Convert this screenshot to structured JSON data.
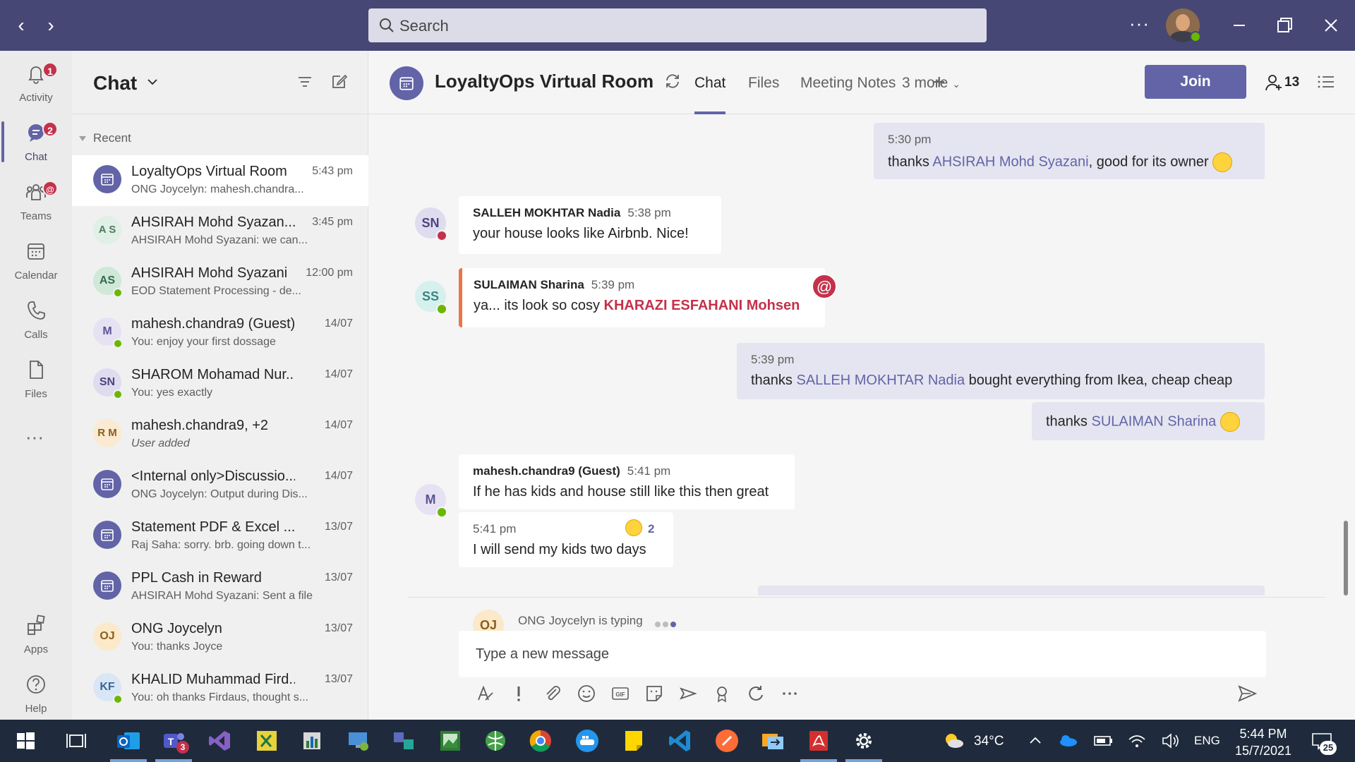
{
  "titlebar": {
    "search_placeholder": "Search",
    "more": "···"
  },
  "rail": [
    {
      "label": "Activity",
      "badge": "1"
    },
    {
      "label": "Chat",
      "badge": "2"
    },
    {
      "label": "Teams",
      "badge": "@"
    },
    {
      "label": "Calendar",
      "badge": ""
    },
    {
      "label": "Calls",
      "badge": ""
    },
    {
      "label": "Files",
      "badge": ""
    },
    {
      "label": "Apps",
      "badge": ""
    },
    {
      "label": "Help",
      "badge": ""
    }
  ],
  "chatlist": {
    "title": "Chat",
    "section": "Recent",
    "items": [
      {
        "initials": "",
        "name": "LoyaltyOps Virtual Room",
        "time": "5:43 pm",
        "preview": "ONG Joycelyn: mahesh.chandra..."
      },
      {
        "initials": "A S",
        "name": "AHSIRAH Mohd Syazan...",
        "time": "3:45 pm",
        "preview": "AHSIRAH Mohd Syazani: we can..."
      },
      {
        "initials": "AS",
        "name": "AHSIRAH Mohd Syazani",
        "time": "12:00 pm",
        "preview": "EOD Statement Processing - de..."
      },
      {
        "initials": "M",
        "name": "mahesh.chandra9 (Guest)",
        "time": "14/07",
        "preview": "You: enjoy your first dossage"
      },
      {
        "initials": "SN",
        "name": "SHAROM Mohamad Nur...",
        "time": "14/07",
        "preview": "You: yes exactly"
      },
      {
        "initials": "R M",
        "name": "mahesh.chandra9, +2",
        "time": "14/07",
        "preview": "User added"
      },
      {
        "initials": "",
        "name": "<Internal only>Discussio...",
        "time": "14/07",
        "preview": "ONG Joycelyn: Output during Dis..."
      },
      {
        "initials": "",
        "name": "Statement PDF & Excel ...",
        "time": "13/07",
        "preview": "Raj Saha: sorry. brb. going down t..."
      },
      {
        "initials": "",
        "name": "PPL Cash in Reward",
        "time": "13/07",
        "preview": "AHSIRAH Mohd Syazani: Sent a file"
      },
      {
        "initials": "OJ",
        "name": "ONG Joycelyn",
        "time": "13/07",
        "preview": "You: thanks Joyce"
      },
      {
        "initials": "KF",
        "name": "KHALID Muhammad Fird...",
        "time": "13/07",
        "preview": "You: oh thanks Firdaus, thought s..."
      }
    ]
  },
  "header": {
    "title": "LoyaltyOps Virtual Room",
    "tabs": [
      "Chat",
      "Files",
      "Meeting Notes",
      "3 more"
    ],
    "join": "Join",
    "participants": "13"
  },
  "messages": {
    "m1": {
      "time": "5:30 pm",
      "pre": "thanks ",
      "mention": "AHSIRAH Mohd Syazani",
      "post": ", good for its owner"
    },
    "m2": {
      "initials": "SN",
      "author": "SALLEH MOKHTAR Nadia",
      "time": "5:38 pm",
      "text": "your house looks like Airbnb. Nice!"
    },
    "m3": {
      "initials": "SS",
      "author": "SULAIMAN Sharina",
      "time": "5:39 pm",
      "pre": "ya... its look so cosy ",
      "mention": "KHARAZI ESFAHANI Mohsen",
      "at": "@"
    },
    "m4": {
      "time": "5:39 pm",
      "pre": "thanks ",
      "mention": "SALLEH MOKHTAR Nadia",
      "post": " bought everything from Ikea, cheap cheap"
    },
    "m5": {
      "pre": "thanks ",
      "mention": "SULAIMAN Sharina"
    },
    "m6": {
      "initials": "M",
      "author": "mahesh.chandra9 (Guest)",
      "time": "5:41 pm",
      "text": "If he has kids and house still like this then great"
    },
    "m7": {
      "time": "5:41 pm",
      "text": "I will send my kids two days",
      "reaction_count": "2"
    }
  },
  "typing": {
    "initials": "OJ",
    "text": "ONG Joycelyn is typing"
  },
  "compose": {
    "placeholder": "Type a new message"
  },
  "taskbar": {
    "teams_badge": "3",
    "weather": "34°C",
    "lang": "ENG",
    "time": "5:44 PM",
    "date": "15/7/2021",
    "notif_count": "25"
  }
}
